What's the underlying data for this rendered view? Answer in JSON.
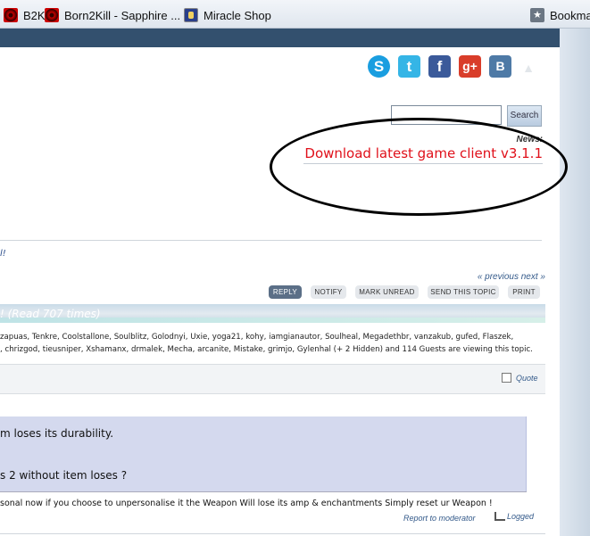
{
  "bookmarks": [
    {
      "label": "B2K",
      "icon": "red-web-icon"
    },
    {
      "label": "Born2Kill - Sapphire ...",
      "icon": "red-web-icon"
    },
    {
      "label": "Miracle Shop",
      "icon": "shop-icon"
    },
    {
      "label": "Bookmark",
      "icon": "bookmarks-icon"
    }
  ],
  "social": {
    "skype": "S",
    "twitter": "t",
    "facebook": "f",
    "googleplus": "g+",
    "vk": "B",
    "up": "▲"
  },
  "search": {
    "value": "",
    "button": "Search"
  },
  "news": {
    "label": "News:",
    "link": "Download latest game client v3.1.1"
  },
  "exclam": "l!",
  "nav": {
    "prevnext": "« previous next »"
  },
  "buttons": {
    "reply": "REPLY",
    "notify": "NOTIFY",
    "mark_unread": "MARK UNREAD",
    "send": "SEND THIS TOPIC",
    "print": "PRINT"
  },
  "topic": {
    "title": "!  (Read 707 times)"
  },
  "viewers": {
    "line1": "zapuas, Tenkre, Coolstallone, Soulblitz, Golodnyi, Uxie, yoga21, kohy, iamgianautor, Soulheal, Megadethbr, vanzakub, gufed, Flaszek,",
    "line2": ", chrizgod, tieusniper, Xshamanx, drmalek, Mecha, arcanite, Mistake, grimjo, Gylenhal (+ 2 Hidden) and 114 Guests are viewing this topic."
  },
  "post": {
    "quote": "Quote",
    "line1": "m loses its durability.",
    "line2": "s 2 without item loses ?",
    "line3": "sonal now if you choose to unpersonalise it the Weapon Will lose its amp & enchantments Simply reset ur Weapon !",
    "report": "Report to moderator",
    "logged": "Logged"
  },
  "colors": {
    "accent": "#345a8a",
    "news": "#e0101a",
    "header": "#33506e"
  }
}
